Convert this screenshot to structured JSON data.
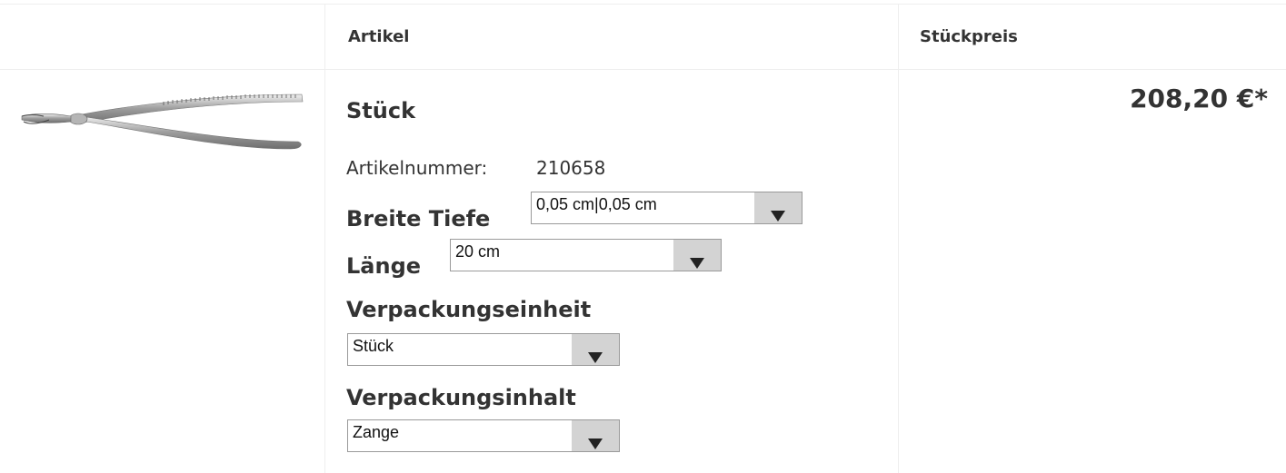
{
  "header": {
    "col_article": "Artikel",
    "col_unit_price": "Stückpreis"
  },
  "product": {
    "image_alt": "Zange",
    "name": "Stück",
    "article_number_label": "Artikelnummer:",
    "article_number": "210658",
    "unit_price": "208,20 €*"
  },
  "options": {
    "breite_tiefe": {
      "label": "Breite Tiefe",
      "selected": "0,05 cm|0,05 cm"
    },
    "laenge": {
      "label": "Länge",
      "selected": "20 cm"
    },
    "verpackungseinheit": {
      "label": "Verpackungseinheit",
      "selected": "Stück"
    },
    "verpackungsinhalt": {
      "label": "Verpackungsinhalt",
      "selected": "Zange"
    }
  },
  "colors": {
    "border": "#eeeeee",
    "text": "#333333",
    "select_button": "#d3d3d3"
  }
}
